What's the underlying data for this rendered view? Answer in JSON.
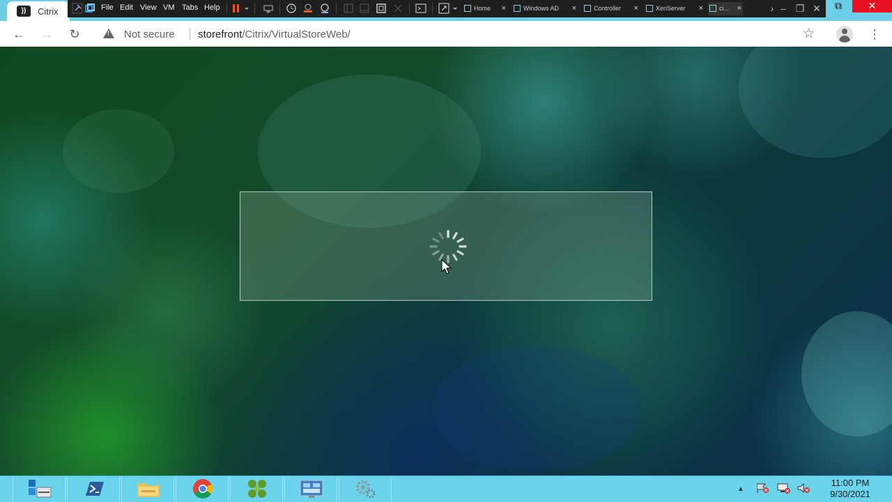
{
  "browser": {
    "tab_title": "Citrix",
    "tab_logo": "citrix-logo",
    "nav": {
      "back_icon": "back-arrow-icon",
      "forward_icon": "forward-arrow-icon",
      "reload_icon": "reload-icon"
    },
    "security_label": "Not secure",
    "url_host": "storefront",
    "url_path": "/Citrix/VirtualStoreWeb/",
    "bookmark_icon": "star-icon",
    "profile_icon": "profile-icon",
    "menu_icon": "kebab-menu-icon"
  },
  "vmware": {
    "menus": [
      "File",
      "Edit",
      "View",
      "VM",
      "Tabs",
      "Help"
    ],
    "tabs": [
      {
        "label": "Home"
      },
      {
        "label": "Windows AD"
      },
      {
        "label": "Controller"
      },
      {
        "label": "XenServer"
      },
      {
        "label": "ci..."
      }
    ]
  },
  "page": {
    "status": "loading"
  },
  "taskbar": {
    "apps": [
      "server-manager-icon",
      "powershell-icon",
      "file-explorer-icon",
      "chrome-icon",
      "citrix-studio-icon",
      "remote-desktop-icon",
      "settings-gears-icon"
    ],
    "clock_time": "11:00 PM",
    "clock_date": "9/30/2021"
  },
  "colors": {
    "taskbar": "#6ad4ec",
    "tab_strip": "#6ccde6",
    "vmware_bar": "#1f1f1f"
  }
}
